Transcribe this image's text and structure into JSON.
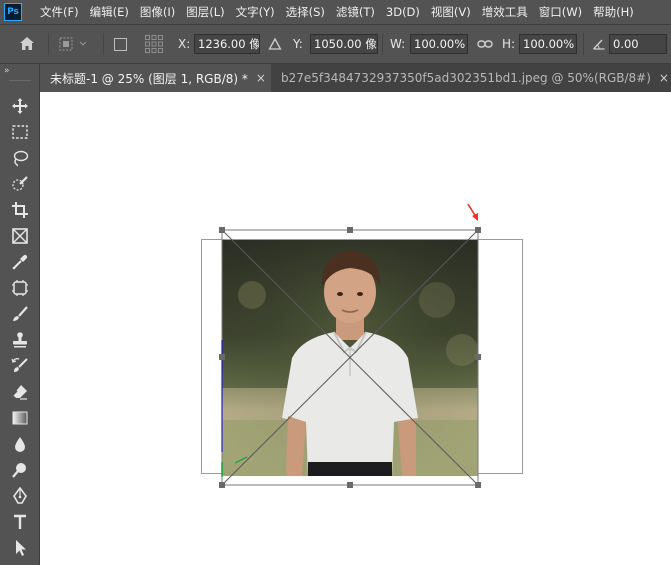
{
  "app": {
    "logo": "Ps"
  },
  "menu": [
    "文件(F)",
    "编辑(E)",
    "图像(I)",
    "图层(L)",
    "文字(Y)",
    "选择(S)",
    "滤镜(T)",
    "3D(D)",
    "视图(V)",
    "增效工具",
    "窗口(W)",
    "帮助(H)"
  ],
  "options": {
    "x_label": "X:",
    "x_value": "1236.00 像",
    "y_label": "Y:",
    "y_value": "1050.00 像",
    "w_label": "W:",
    "w_value": "100.00%",
    "h_label": "H:",
    "h_value": "100.00%",
    "angle_value": "0.00"
  },
  "tabs": [
    {
      "label": "未标题-1 @ 25% (图层 1, RGB/8) *",
      "close": "×",
      "active": true
    },
    {
      "label": "b27e5f3484732937350f5ad302351bd1.jpeg @ 50%(RGB/8#)",
      "close": "×",
      "active": false
    }
  ],
  "colors": {
    "ui_bg": "#535353",
    "tab_bar": "#424242",
    "canvas": "#ffffff",
    "arrow": "#e8322b",
    "shirt": "#e9e9e7"
  },
  "icons": [
    "home-icon",
    "marquee-options-icon",
    "move-tool-icon",
    "rect-marquee-icon",
    "lasso-icon",
    "quick-select-icon",
    "crop-icon",
    "frame-icon",
    "eyedropper-icon",
    "patch-icon",
    "brush-icon",
    "stamp-icon",
    "history-brush-icon",
    "eraser-icon",
    "gradient-icon",
    "blur-icon",
    "dodge-icon",
    "pen-icon",
    "type-icon",
    "path-select-icon"
  ]
}
